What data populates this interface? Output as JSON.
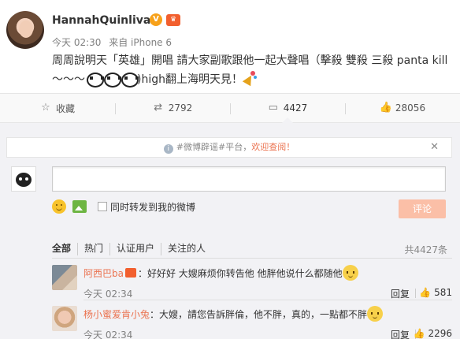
{
  "post": {
    "username": "HannahQuinlivan",
    "time": "今天 02:30",
    "source": "来自 iPhone 6",
    "text_line1": "周周說明天「英雄」開唱 請大家副歌跟他一起大聲唱（擊殺 雙殺 三殺 panta kill",
    "text_line2_prefix": "～～～",
    "text_line2_suffix": ")high翻上海明天見！",
    "icons": [
      "verified-badge",
      "vip-badge",
      "panda-emoji",
      "party-popper-emoji"
    ]
  },
  "actions": [
    {
      "icon": "star-icon",
      "glyph": "☆",
      "label": "收藏"
    },
    {
      "icon": "repost-icon",
      "glyph": "⇄",
      "label": "2792"
    },
    {
      "icon": "comment-icon",
      "glyph": "▭",
      "label": "4427"
    },
    {
      "icon": "like-icon",
      "glyph": "👍",
      "label": "28056"
    }
  ],
  "notice": {
    "prefix": "#微博辟谣#平台，",
    "highlight": "欢迎查阅！",
    "close": "✕"
  },
  "composer": {
    "placeholder": "",
    "repost_label": "同时转发到我的微博",
    "submit_label": "评论"
  },
  "filters": {
    "tabs": [
      "全部",
      "热门",
      "认证用户",
      "关注的人"
    ],
    "count": "共4427条"
  },
  "comments": [
    {
      "user": "阿西巴ba",
      "text": "：好好好 大嫂麻烦你转告他 他胖他说什么都随他",
      "time": "今天 02:34",
      "reply": "回复",
      "likes": "581"
    },
    {
      "user": "杨小蜜爱肯小兔",
      "text": "：大嫂，請您告訴胖倫，他不胖，真的，一點都不胖",
      "time": "今天 02:34",
      "reply": "回复",
      "likes": "2296"
    }
  ],
  "colors": {
    "accent": "#eb7350",
    "submit_disabled": "#fbbfa7",
    "panel_bg": "#f2f2f5"
  }
}
